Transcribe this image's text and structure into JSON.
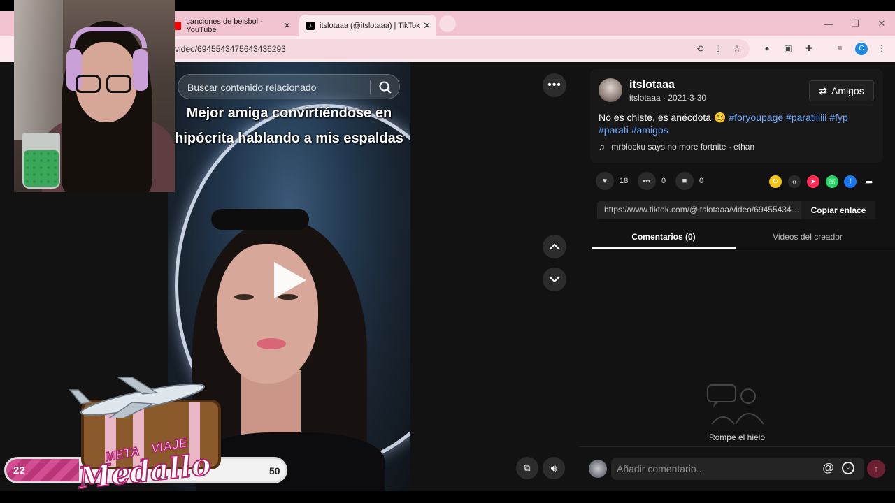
{
  "browser": {
    "tabs": [
      {
        "title": "canciones de beisbol - YouTube",
        "favicon": "youtube-icon"
      },
      {
        "title": "itslotaaa (@itslotaaa) | TikTok",
        "favicon": "tiktok-icon"
      }
    ],
    "url": "video/6945543475643436293",
    "profile_initial": "C"
  },
  "video": {
    "search_placeholder": "Buscar contenido relacionado",
    "caption": "Mejor amiga convirtiéndose en hipócrita hablando a mis espaldas"
  },
  "author": {
    "username": "itslotaaa",
    "handle_date": "itslotaaa · 2021-3-30",
    "friends_label": "Amigos"
  },
  "description": {
    "text": "No es chiste, es anécdota 🥴",
    "tags": [
      "#foryoupage",
      "#paratiiiiii",
      "#fyp",
      "#parati",
      "#amigos"
    ]
  },
  "music": "mrblocku says no more fortnite - ethan",
  "stats": {
    "likes": "18",
    "comments": "0",
    "saves": "0"
  },
  "share": {
    "link": "https://www.tiktok.com/@itslotaaa/video/6945543475643436293",
    "copy_label": "Copiar enlace",
    "colors": {
      "repost": "#f5c518",
      "telegram": "#fe2c55",
      "whatsapp": "#25d366",
      "facebook": "#1877f2"
    }
  },
  "tabs": {
    "comments": "Comentarios (0)",
    "creator": "Videos del creador"
  },
  "empty_state": "Rompe el hielo",
  "comment_input": {
    "placeholder": "Añadir comentario..."
  },
  "overlay": {
    "progress_start": "22",
    "progress_end": "50",
    "progress_fraction": 0.26,
    "badge_word1": "META",
    "badge_word2": "VIAJE",
    "badge_word3": "Medallo"
  },
  "accent": "#fe2c55"
}
